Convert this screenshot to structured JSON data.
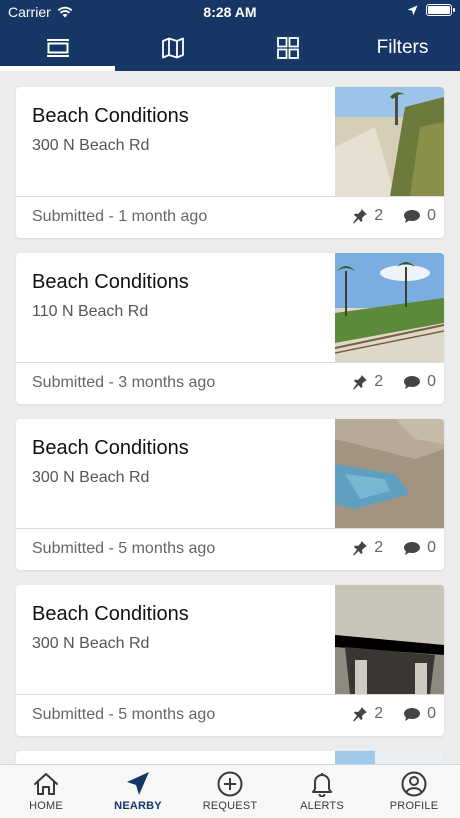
{
  "status_bar": {
    "carrier": "Carrier",
    "time": "8:28 AM"
  },
  "header": {
    "tabs": [
      {
        "icon": "list-icon",
        "active": true
      },
      {
        "icon": "map-icon",
        "active": false
      },
      {
        "icon": "grid-icon",
        "active": false
      },
      {
        "label": "Filters",
        "active": false
      }
    ]
  },
  "requests": [
    {
      "title": "Beach Conditions",
      "address": "300   N Beach Rd",
      "submitted": "Submitted - 1 month ago",
      "pins": "2",
      "comments": "0"
    },
    {
      "title": "Beach Conditions",
      "address": "110   N Beach Rd",
      "submitted": "Submitted - 3 months ago",
      "pins": "2",
      "comments": "0"
    },
    {
      "title": "Beach Conditions",
      "address": "300   N Beach Rd",
      "submitted": "Submitted - 5 months ago",
      "pins": "2",
      "comments": "0"
    },
    {
      "title": "Beach Conditions",
      "address": "300   N Beach Rd",
      "submitted": "Submitted - 5 months ago",
      "pins": "2",
      "comments": "0"
    }
  ],
  "bottom_nav": {
    "items": [
      {
        "label": "HOME",
        "icon": "home-icon"
      },
      {
        "label": "NEARBY",
        "icon": "navigation-arrow-icon",
        "active": true
      },
      {
        "label": "REQUEST",
        "icon": "plus-circle-icon"
      },
      {
        "label": "ALERTS",
        "icon": "bell-icon"
      },
      {
        "label": "PROFILE",
        "icon": "user-circle-icon"
      }
    ]
  },
  "colors": {
    "header": "#163765",
    "accent": "#163765",
    "background": "#ececec"
  }
}
